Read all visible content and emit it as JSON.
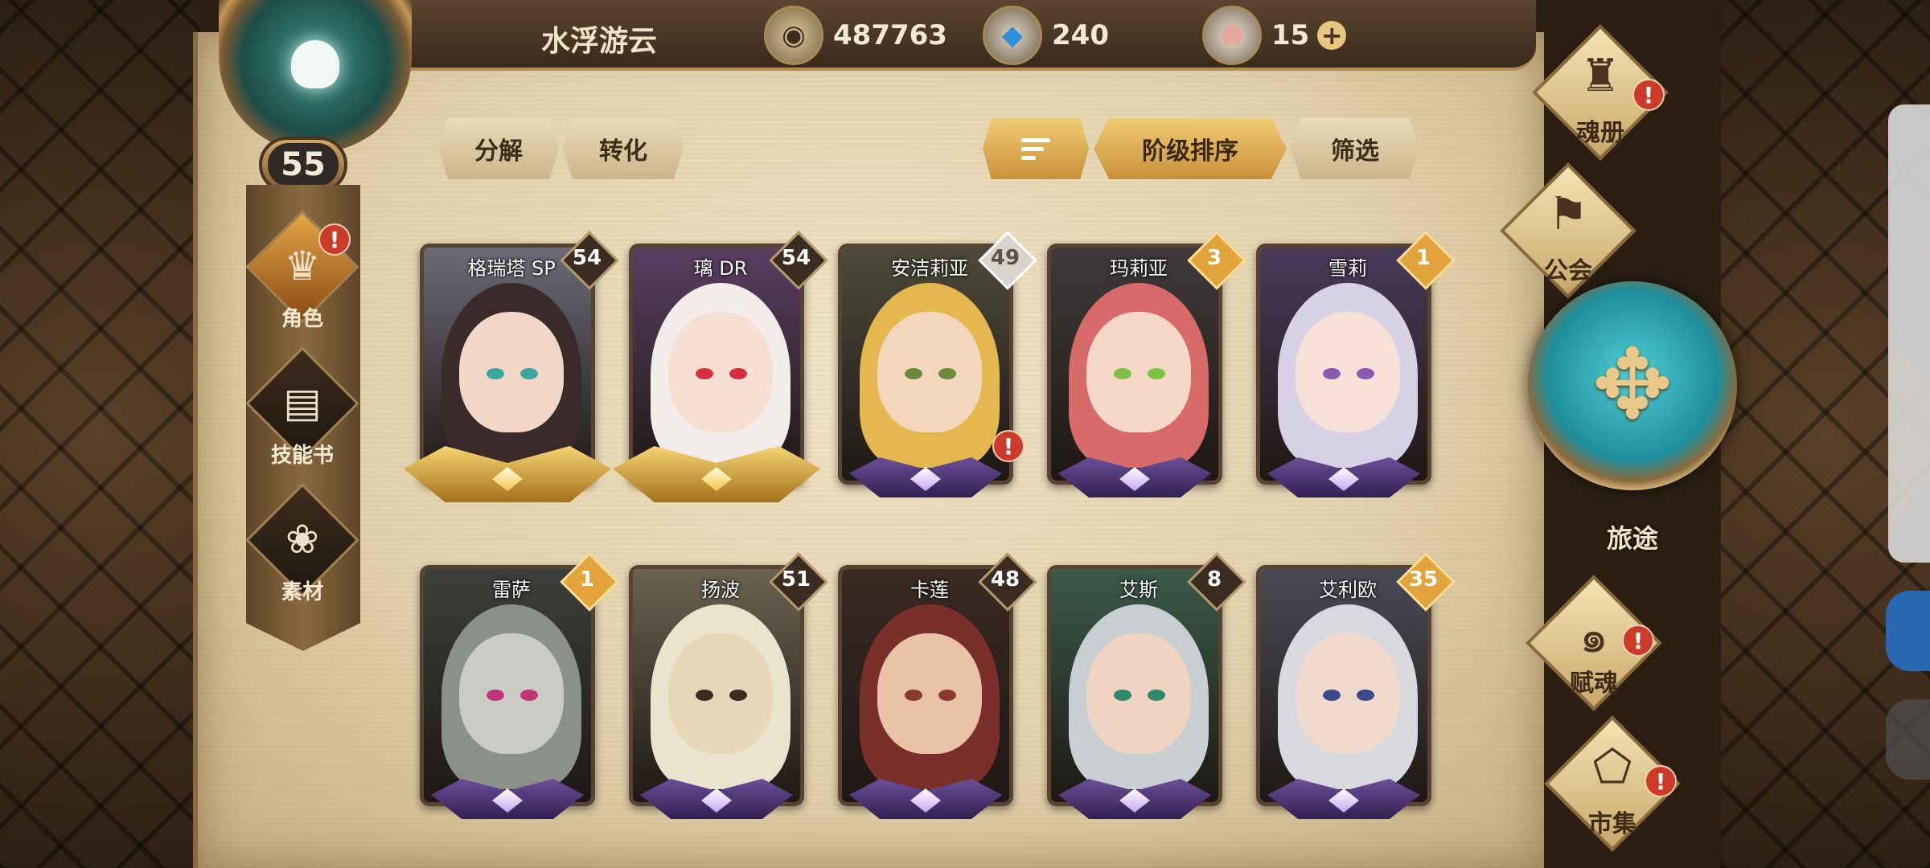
{
  "player": {
    "name": "水浮游云",
    "level": "55"
  },
  "currencies": [
    {
      "icon": "gold-coin-icon",
      "value": "487763"
    },
    {
      "icon": "blue-crystal-icon",
      "value": "240"
    },
    {
      "icon": "pink-gem-icon",
      "value": "15"
    }
  ],
  "left_nav": [
    {
      "label": "角色",
      "icon": "character-icon",
      "active": true,
      "alert": true
    },
    {
      "label": "技能书",
      "icon": "skillbook-icon",
      "active": false,
      "alert": false
    },
    {
      "label": "素材",
      "icon": "material-icon",
      "active": false,
      "alert": false
    }
  ],
  "actions": {
    "decompose": "分解",
    "convert": "转化",
    "sort_order": "阶级排序",
    "filter": "筛选"
  },
  "cards": [
    {
      "name": "格瑞塔 SP",
      "level": "54",
      "rank": "gold",
      "badge": "dark",
      "hair": "#3b2a2a",
      "skin": "#f3d7c6",
      "bg": "#6b6a77",
      "eye": "#3aa6a0"
    },
    {
      "name": "璃 DR",
      "level": "54",
      "rank": "gold",
      "badge": "dark",
      "hair": "#f2eceb",
      "skin": "#f7dfd4",
      "bg": "#5a3e62",
      "eye": "#d72d3c"
    },
    {
      "name": "安洁莉亚",
      "level": "49",
      "rank": "purple",
      "badge": "silver",
      "hair": "#e4b84f",
      "skin": "#f4d6bc",
      "bg": "#4d4a3a",
      "eye": "#6b8a3a",
      "alert": true
    },
    {
      "name": "玛莉亚",
      "level": "3",
      "rank": "purple",
      "badge": "gold",
      "hair": "#d86a6a",
      "skin": "#f6d8c6",
      "bg": "#3f3a3a",
      "eye": "#7cc243"
    },
    {
      "name": "雪莉",
      "level": "1",
      "rank": "purple",
      "badge": "gold",
      "hair": "#d6d1e4",
      "skin": "#f7e0d8",
      "bg": "#4a3a5a",
      "eye": "#8a5ab0"
    },
    {
      "name": "雷萨",
      "level": "1",
      "rank": "purple",
      "badge": "gold",
      "hair": "#8b918a",
      "skin": "#c8ccc4",
      "bg": "#3b3f3a",
      "eye": "#c0347a"
    },
    {
      "name": "扬波",
      "level": "51",
      "rank": "purple",
      "badge": "dark",
      "hair": "#ece3cf",
      "skin": "#e6d7b8",
      "bg": "#6a6250",
      "eye": "#3a2c1e"
    },
    {
      "name": "卡莲",
      "level": "48",
      "rank": "purple",
      "badge": "dark",
      "hair": "#7a2f2a",
      "skin": "#e9c2a8",
      "bg": "#3a2a22",
      "eye": "#8a3a2a"
    },
    {
      "name": "艾斯",
      "level": "8",
      "rank": "purple",
      "badge": "dark",
      "hair": "#c9ced2",
      "skin": "#efd4c2",
      "bg": "#3a5a4a",
      "eye": "#2e8a6a"
    },
    {
      "name": "艾利欧",
      "level": "35",
      "rank": "purple",
      "badge": "gold",
      "hair": "#d7d9df",
      "skin": "#f0d8cc",
      "bg": "#4a4a55",
      "eye": "#3a4a8a"
    }
  ],
  "right_menu": [
    {
      "label": "魂册",
      "icon": "soulbook-icon",
      "alert": true
    },
    {
      "label": "公会",
      "icon": "guild-icon",
      "alert": false
    },
    {
      "label": "赋魂",
      "icon": "soul-imbue-icon",
      "alert": true
    },
    {
      "label": "市集",
      "icon": "market-icon",
      "alert": true
    }
  ],
  "journey": {
    "label": "旅途"
  }
}
